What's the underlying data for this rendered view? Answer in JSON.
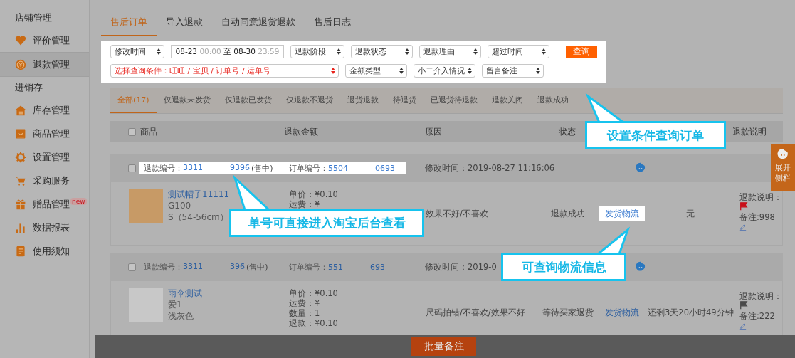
{
  "sidebar": {
    "sections": [
      {
        "title": "店铺管理",
        "items": [
          {
            "label": "评价管理",
            "selected": false
          },
          {
            "label": "退款管理",
            "selected": true
          }
        ]
      },
      {
        "title": "进销存",
        "items": [
          {
            "label": "库存管理",
            "selected": false
          },
          {
            "label": "商品管理",
            "selected": false
          },
          {
            "label": "设置管理",
            "selected": false
          },
          {
            "label": "采购服务",
            "selected": false
          },
          {
            "label": "赠品管理",
            "selected": false,
            "badge": "new"
          },
          {
            "label": "数据报表",
            "selected": false
          },
          {
            "label": "使用须知",
            "selected": false
          }
        ]
      }
    ]
  },
  "tabs": [
    {
      "label": "售后订单",
      "selected": true
    },
    {
      "label": "导入退款",
      "selected": false
    },
    {
      "label": "自动同意退货退款",
      "selected": false
    },
    {
      "label": "售后日志",
      "selected": false
    }
  ],
  "filters": {
    "time_select": "修改时间",
    "date_range": {
      "start_date": "08-23",
      "start_time": "00:00",
      "separator": "至",
      "end_date": "08-30",
      "end_time": "23:59"
    },
    "selects": [
      "退款阶段",
      "退款状态",
      "退款理由",
      "超过时间"
    ],
    "query_button": "查询",
    "condition_select": "选择查询条件：旺旺 / 宝贝 / 订单号 / 运单号",
    "more_selects": [
      "金额类型",
      "小二介入情况",
      "留言备注"
    ]
  },
  "status_tabs": [
    {
      "label": "全部(17)",
      "selected": true
    },
    {
      "label": "仅退款未发货",
      "selected": false
    },
    {
      "label": "仅退款已发货",
      "selected": false
    },
    {
      "label": "仅退款不退货",
      "selected": false
    },
    {
      "label": "退货退款",
      "selected": false
    },
    {
      "label": "待退货",
      "selected": false
    },
    {
      "label": "已退货待退款",
      "selected": false
    },
    {
      "label": "退款关闭",
      "selected": false
    },
    {
      "label": "退款成功",
      "selected": false
    }
  ],
  "table": {
    "checked": false,
    "columns": [
      "商品",
      "退款金额",
      "原因",
      "状态",
      "退款说明"
    ],
    "orders": [
      {
        "checked": false,
        "highlighted": true,
        "refund_label": "退款编号：",
        "refund_no_start": "3311",
        "refund_no_end": "9396",
        "sale_state": "(售中)",
        "order_label": "订单编号：",
        "order_no_start": "5504",
        "order_no_end": "0693",
        "modified": "修改时间：2019-08-27 11:16:06",
        "product": {
          "title": "测试帽子11111",
          "sku": "G100",
          "variant": "S（54-56cm）"
        },
        "amounts": [
          "单价：¥0.10",
          "运费：¥"
        ],
        "reason": "效果不好/不喜欢",
        "status": "退款成功",
        "logistics": {
          "label": "发货物流",
          "highlighted": true
        },
        "time": "无",
        "remark": {
          "label": "退款说明：",
          "color": "#c8101a",
          "note": "备注:998"
        }
      },
      {
        "checked": false,
        "highlighted": false,
        "refund_label": "退款编号：",
        "refund_no_start": "3311",
        "refund_no_end": "396",
        "sale_state": "(售中)",
        "order_label": "订单编号：",
        "order_no_start": "551",
        "order_no_end": "693",
        "modified": "修改时间：2019-0",
        "product": {
          "title": "雨伞测试",
          "sku": "爱1",
          "variant": "浅灰色"
        },
        "amounts": [
          "单价：¥0.10",
          "运费：¥",
          "数量：1",
          "退款：¥0.10"
        ],
        "reason": "尺码拍错/不喜欢/效果不好",
        "status": "等待买家退货",
        "logistics": {
          "label": "发货物流",
          "highlighted": false
        },
        "time": "还剩3天20小时49分钟",
        "remark": {
          "label": "退款说明：",
          "color": "#4a4a4a",
          "note": "备注:222"
        }
      }
    ]
  },
  "side_tab": {
    "label": "展开侧栏"
  },
  "bottom_bar": {
    "button": "批量备注"
  },
  "callouts": [
    {
      "text": "设置条件查询订单",
      "kind": "filters"
    },
    {
      "text": "单号可直接进入淘宝后台查看",
      "kind": "order_no"
    },
    {
      "text": "可查询物流信息",
      "kind": "logistics"
    }
  ]
}
